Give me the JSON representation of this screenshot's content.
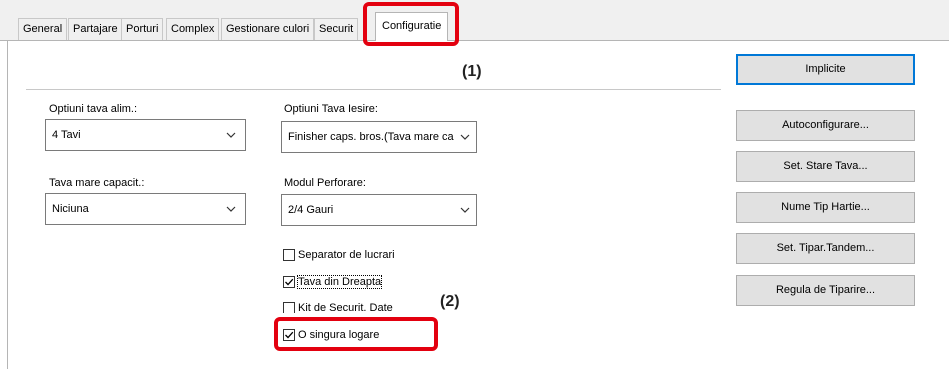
{
  "tabs": [
    {
      "label": "General"
    },
    {
      "label": "Partajare"
    },
    {
      "label": "Porturi"
    },
    {
      "label": "Complex"
    },
    {
      "label": "Gestionare culori"
    },
    {
      "label": "Securit"
    },
    {
      "label": "Configuratie",
      "active": true
    }
  ],
  "callouts": {
    "one": "(1)",
    "two": "(2)"
  },
  "buttons": {
    "implicite": "Implicite",
    "autoconfigurare": "Autoconfigurare...",
    "set_stare_tava": "Set. Stare Tava...",
    "nume_tip_hartie": "Nume Tip Hartie...",
    "set_tipar_tandem": "Set. Tipar.Tandem...",
    "regula_de_tiparire": "Regula de Tiparire..."
  },
  "fields": {
    "optiuni_tava_alim": {
      "label": "Optiuni tava alim.:",
      "value": "4 Tavi"
    },
    "optiuni_tava_iesire": {
      "label": "Optiuni Tava Iesire:",
      "value": "Finisher caps. bros.(Tava mare cap"
    },
    "tava_mare_capacit": {
      "label": "Tava mare capacit.:",
      "value": "Niciuna"
    },
    "modul_perforare": {
      "label": "Modul Perforare:",
      "value": "2/4 Gauri"
    }
  },
  "checkboxes": [
    {
      "label": "Separator de lucrari",
      "checked": false
    },
    {
      "label": "Tava din Dreapta",
      "checked": true
    },
    {
      "label": "Kit de Securit. Date",
      "checked": false
    },
    {
      "label": "O singura logare",
      "checked": true
    }
  ],
  "colors": {
    "highlight": "#e3000f",
    "focus_border": "#0078d7"
  }
}
